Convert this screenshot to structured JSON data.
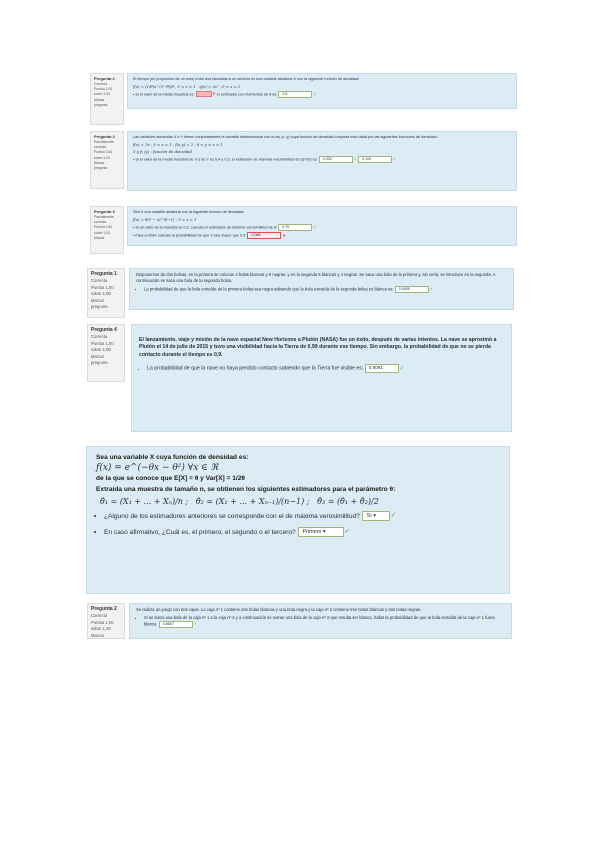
{
  "q1": {
    "info": {
      "number": "Pregunta 2",
      "lines": [
        "Correcta",
        "Puntúa 1,00",
        "sobre 1,00",
        "Marcar",
        "pregunta"
      ]
    },
    "text": "El tiempo (en proporción de un mes) entre dos llamadas a un servicio es una variable aleatoria X con la siguiente función de densidad:",
    "formula1": "f(x) = (1/θ)x^(1−θ)/θ , 0 < x < 1",
    "formula2": "q(x) = 3x² ; 0 < x < 1",
    "item_a": "Si el valor de la media muestral es:",
    "item_b": "el estimador por momentos de θ es:",
    "answer": "0,5",
    "check": "✓",
    "cross": "✗"
  },
  "q2": {
    "info": {
      "number": "Pregunta 3",
      "lines": [
        "Parcialmente correcta",
        "Puntúa 0,50",
        "sobre 1,00",
        "Marcar",
        "pregunta"
      ]
    },
    "text": "Las variables aleatorias X e Y tienen conjuntamente la variable bidimensional con la ley (x, y) cuya función de densidad conjunta está dada por las siguientes funciones de densidad:",
    "formula1": "f(x) = 2x ; 0 < x < 1 ;   f(x,y) = 2 ; 0 < y < x < 1",
    "formula2": "Y  y  f₂ (y) : función de densidad",
    "item": "Si el valor de la media muestral de X y de Y es 0,4 y 0,3, el estimador de máxima verosimilitud de E(Y|X) es:",
    "answer1": "0,333",
    "answer2": "0,100",
    "check": "✓",
    "cross": "✗"
  },
  "q3": {
    "info": {
      "number": "Pregunta 3",
      "lines": [
        "Parcialmente",
        "correcta",
        "Puntúa 0,50",
        "sobre 1,00",
        "Marcar",
        "pregunta"
      ]
    },
    "text": "Sea X una variable aleatoria con la siguiente función de densidad:",
    "formula": "f(x) = θ(1 − x)^(θ−1) ; 0 < x < 1",
    "item_a": "Si un valor de la muestra es 0,2, calcular el estimador de máxima verosimilitud de θ:",
    "answer_a": "0,75",
    "item_b": "Para el EMV calcular la probabilidad de que X sea mayor que 0,5:",
    "answer_b": "0,068",
    "check": "✓",
    "cross": "✗"
  },
  "q4": {
    "info": {
      "number": "Pregunta 1",
      "lines": [
        "Correcta",
        "Puntúa 1,00",
        "sobre 1,00",
        "Marcar",
        "pregunta"
      ]
    },
    "text": "Disponemos de dos bolsas, en la primera se colocan 4 bolas blancas y 6 negras, y en la segunda 6 blancas y 4 negras. Se saca una bola de la primera y, sin verla, se introduce en la segunda. A continuación se saca una bola de la segunda bolsa.",
    "item": "La probabilidad de que la bola extraída de la primera bolsa sea negra sabiendo que la bola extraída de la segunda bolsa es blanca es:",
    "answer": "0,5455",
    "check": "✓"
  },
  "q5": {
    "info": {
      "number": "Pregunta 4",
      "lines": [
        "Correcta",
        "Puntúa 1,00",
        "sobre 1,00",
        "Marcar",
        "pregunta"
      ]
    },
    "text": "El lanzamiento, viaje y misión de la nave espacial New Horizons a Plutón (NASA) fue un éxito, después de varias intentos. La nave se aproximó a Plutón el 14 de julio de 2015 y tuvo una visibilidad hacia la Tierra de 0,99 durante ese tiempo. Sin embargo, la probabilidad de que no se pierda contacto durante el tiempo es 0,9.",
    "item": "La probabilidad de que la nave no haya perdido contacto sabiendo que la Tierra fue visible es:",
    "answer": "0,9091",
    "check": "✓"
  },
  "q6": {
    "intro": "Sea una variable X cuya función de densidad es:",
    "formula": "f(x) = e^(−θx − θ²) ∀x ∈ ℜ",
    "given": "de la que se conoce que E[X] = θ y Var[X] = 1/2θ",
    "sample": "Extraída una muestra de tamaño n, se obtienen los siguientes estimadores para el parámetro θ:",
    "est1": "θ̂₁ = (X₁ + ... + Xₙ)/n",
    "est2": "θ̂₂ = (X₁ + ... + Xₙ₋₁)/(n−1)",
    "est3": "θ̂₃ = (θ̂₁ + θ̂₂)/2",
    "item_a": "¿Alguno de los estimadores anteriores se corresponde con el de máxima verosimilitud?",
    "answer_a": "Sí",
    "item_b": "En caso afirmativo, ¿Cuál es, el primero, el segundo o el tercero?",
    "answer_b": "Primero",
    "check": "✓"
  },
  "q7": {
    "info": {
      "number": "Pregunta 2",
      "lines": [
        "Correcta",
        "Puntúa 1,00",
        "sobre 1,00",
        "Marcar",
        "pregunta"
      ]
    },
    "text": "Se realiza un juego con dos cajas. La caja nº 1 contiene dos bolas blancas y una bola negra y la caja nº 2 contiene tres bolas blancas y dos bolas negras.",
    "item": "Si se lanza una bola de la caja nº 1 a la caja nº 2 y a continuación se extrae una bola de la caja nº 2 que resulta ser blanca, hallar la probabilidad de que la bola extraída de la caja nº 1 fuera blanca.",
    "answer": "0,6667",
    "check": "✓"
  }
}
